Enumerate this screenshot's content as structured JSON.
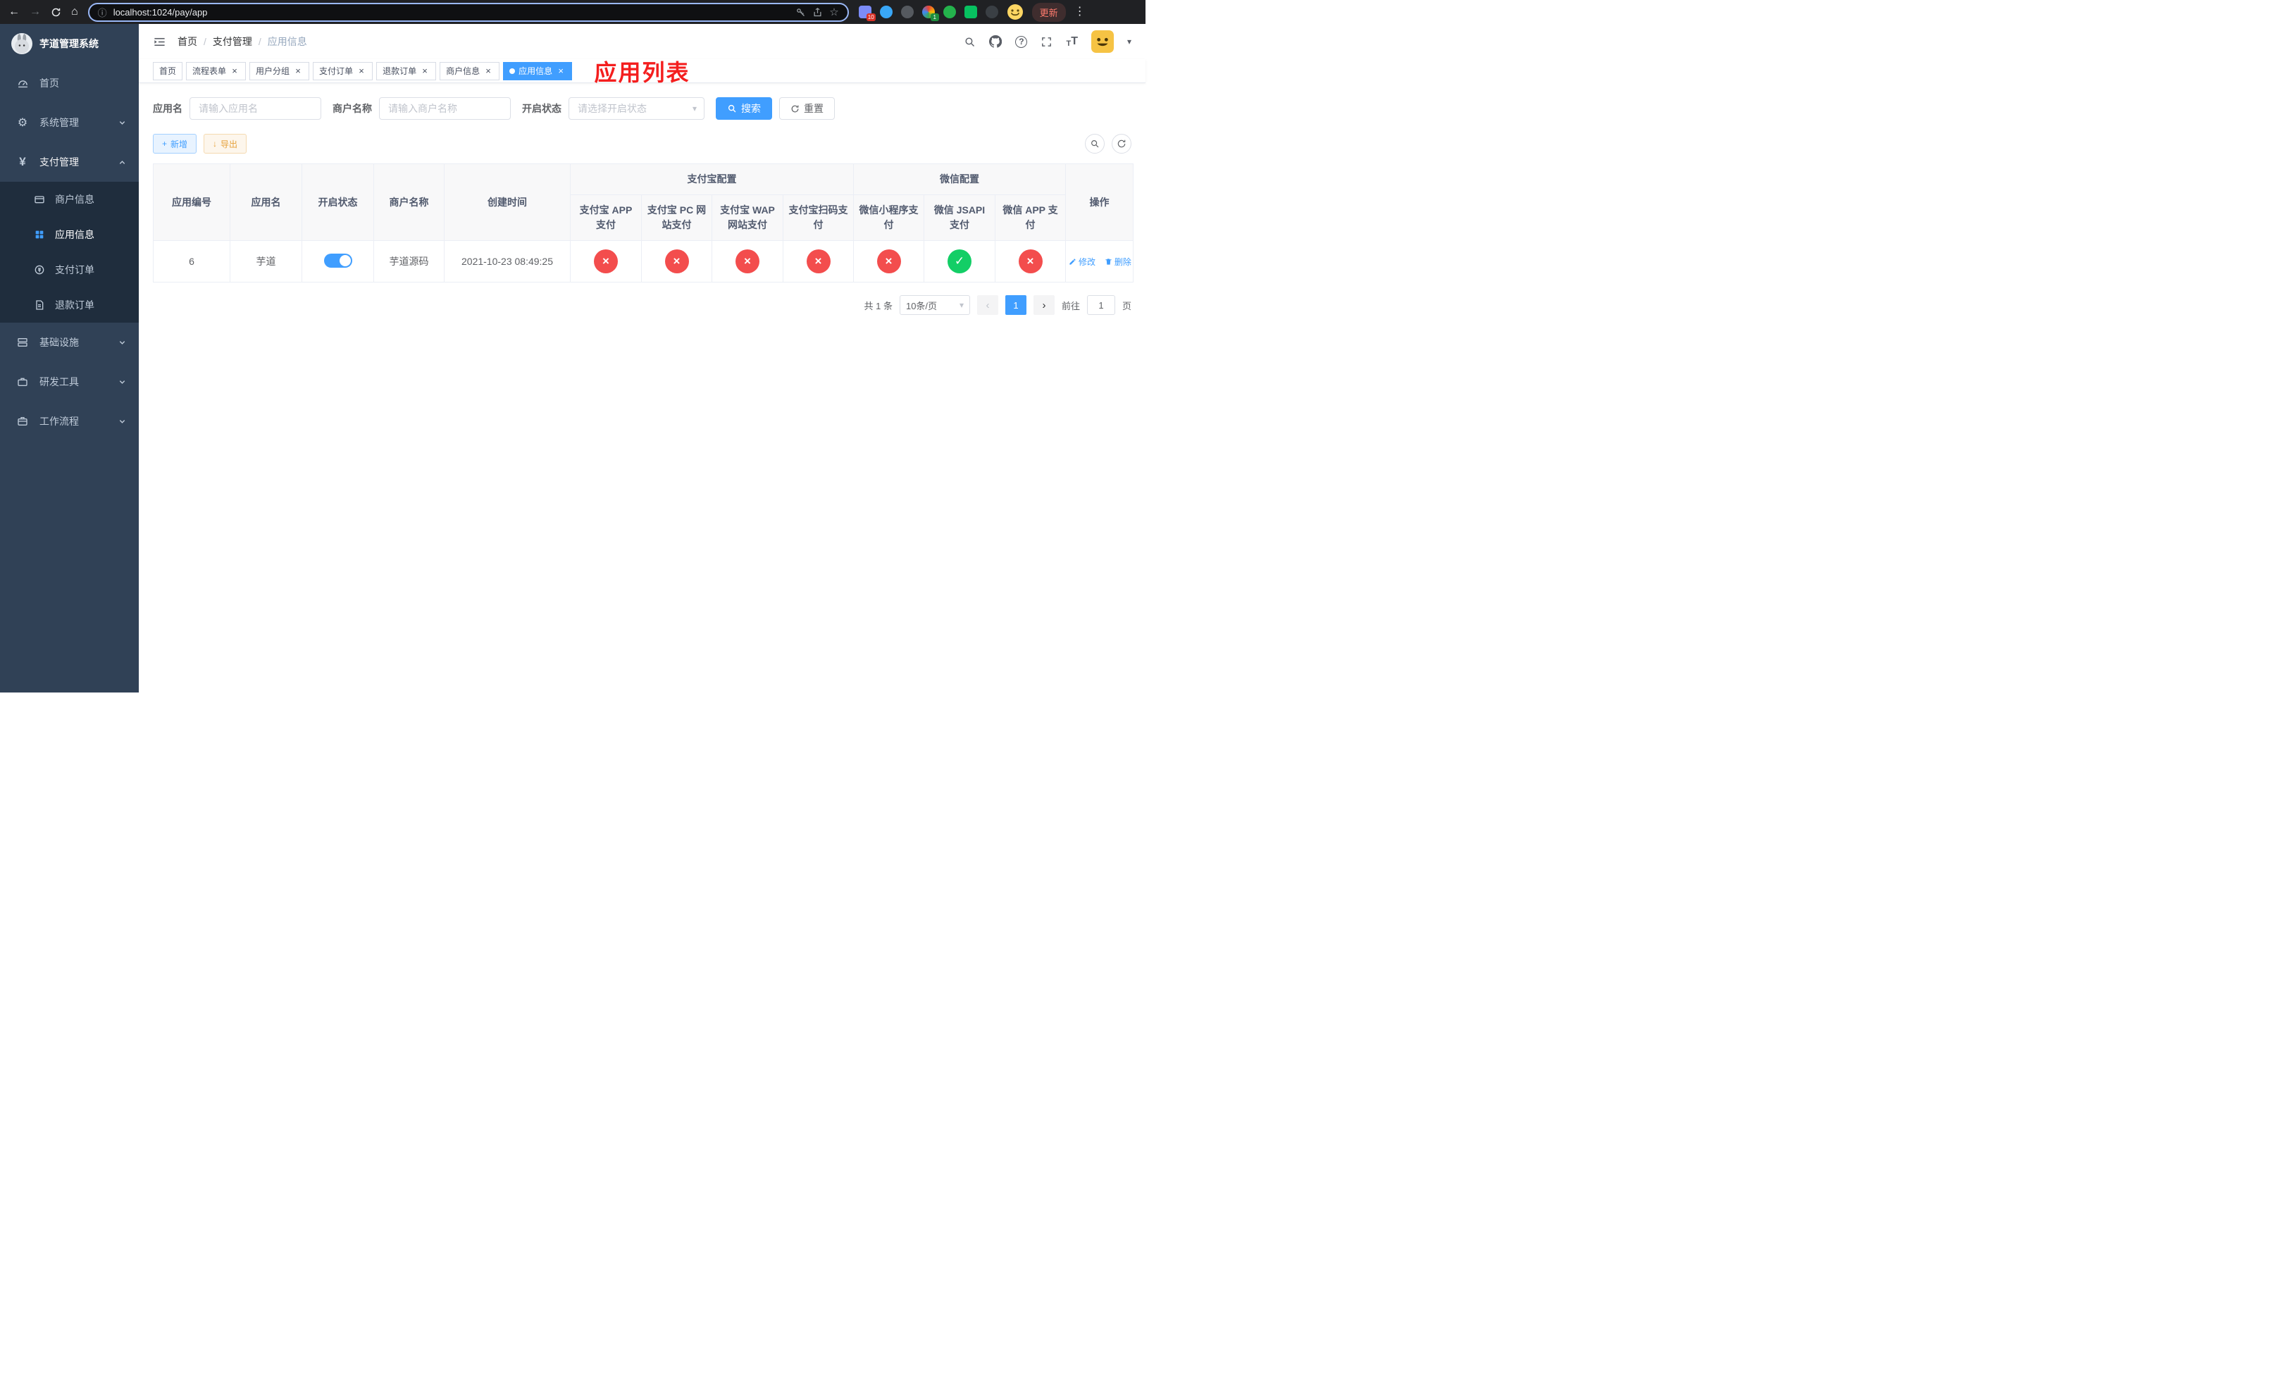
{
  "colors": {
    "primary": "#409eff",
    "danger": "#f34d4d",
    "success": "#13ce66",
    "sidebar_bg": "#304156",
    "overlay_red": "#f41e1e"
  },
  "icons": {
    "back": "←",
    "forward": "→",
    "home": "⌂",
    "info": "ⓘ",
    "star": "☆",
    "kebab": "⋮",
    "gear": "⚙",
    "yen": "¥",
    "question": "?",
    "caret": "▾",
    "plus": "+",
    "download": "↓",
    "close": "×",
    "check": "✓",
    "cross": "×",
    "prev": "‹",
    "next": "›",
    "font_big": "T",
    "font_small": "T"
  },
  "browser": {
    "url": "localhost:1024/pay/app",
    "update_label": "更新",
    "ext_badge_10": "10",
    "ext_badge_1": "1"
  },
  "sidebar": {
    "title": "芋道管理系统",
    "items": [
      {
        "label": "首页"
      },
      {
        "label": "系统管理"
      },
      {
        "label": "支付管理",
        "children": [
          {
            "label": "商户信息"
          },
          {
            "label": "应用信息"
          },
          {
            "label": "支付订单"
          },
          {
            "label": "退款订单"
          }
        ]
      },
      {
        "label": "基础设施"
      },
      {
        "label": "研发工具"
      },
      {
        "label": "工作流程"
      }
    ]
  },
  "header": {
    "breadcrumb": [
      "首页",
      "支付管理",
      "应用信息"
    ],
    "breadcrumb_sep": "/",
    "overlay_title": "应用列表"
  },
  "tabs": [
    {
      "label": "首页"
    },
    {
      "label": "流程表单"
    },
    {
      "label": "用户分组"
    },
    {
      "label": "支付订单"
    },
    {
      "label": "退款订单"
    },
    {
      "label": "商户信息"
    },
    {
      "label": "应用信息"
    }
  ],
  "filters": {
    "app_name_label": "应用名",
    "app_name_placeholder": "请输入应用名",
    "merchant_label": "商户名称",
    "merchant_placeholder": "请输入商户名称",
    "status_label": "开启状态",
    "status_placeholder": "请选择开启状态",
    "search_label": "搜索",
    "reset_label": "重置"
  },
  "toolbar": {
    "add_label": "新增",
    "export_label": "导出"
  },
  "table": {
    "group_alipay": "支付宝配置",
    "group_wechat": "微信配置",
    "cols": {
      "id": "应用编号",
      "name": "应用名",
      "status": "开启状态",
      "merchant": "商户名称",
      "created": "创建时间",
      "alipay_app": "支付宝 APP 支付",
      "alipay_pc": "支付宝 PC 网站支付",
      "alipay_wap": "支付宝 WAP 网站支付",
      "alipay_qr": "支付宝扫码支付",
      "wx_lite": "微信小程序支付",
      "wx_jsapi": "微信 JSAPI 支付",
      "wx_app": "微信 APP 支付",
      "ops": "操作"
    },
    "row": {
      "id": "6",
      "name": "芋道",
      "enabled": true,
      "merchant": "芋道源码",
      "created": "2021-10-23 08:49:25",
      "configs": {
        "alipay_app": false,
        "alipay_pc": false,
        "alipay_wap": false,
        "alipay_qr": false,
        "wx_lite": false,
        "wx_jsapi": true,
        "wx_app": false
      },
      "edit_label": "修改",
      "delete_label": "删除"
    }
  },
  "pagination": {
    "total": "共 1 条",
    "page_size": "10条/页",
    "page": "1",
    "goto_label": "前往",
    "goto_value": "1",
    "unit_label": "页"
  }
}
